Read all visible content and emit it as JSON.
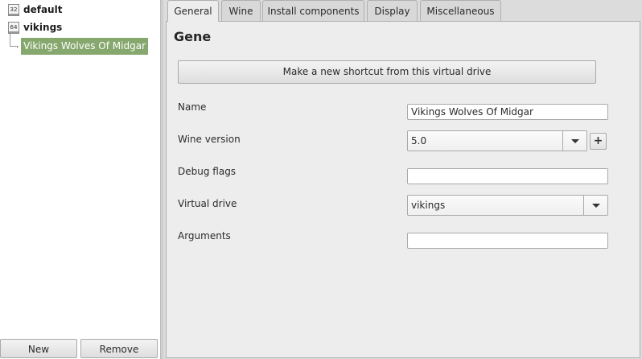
{
  "tree": {
    "items": [
      {
        "badge": "32",
        "label": "default"
      },
      {
        "badge": "64",
        "label": "vikings"
      }
    ],
    "selected_shortcut": "Vikings Wolves Of Midgar"
  },
  "left_buttons": {
    "new_label": "New",
    "remove_label": "Remove"
  },
  "tabs": [
    "General",
    "Wine",
    "Install components",
    "Display",
    "Miscellaneous"
  ],
  "active_tab": "General",
  "general": {
    "heading": "Gene",
    "make_shortcut_label": "Make a new shortcut from this virtual drive",
    "name_label": "Name",
    "name_value": "Vikings Wolves Of Midgar",
    "wine_version_label": "Wine version",
    "wine_version_value": "5.0",
    "plus_label": "+",
    "debug_flags_label": "Debug flags",
    "debug_flags_value": "",
    "virtual_drive_label": "Virtual drive",
    "virtual_drive_value": "vikings",
    "arguments_label": "Arguments",
    "arguments_value": ""
  },
  "colors": {
    "selection": "#86a86e",
    "panel_bg": "#ededed",
    "window_bg": "#dcdcdc"
  },
  "icons": {
    "drive": "drive-icon",
    "shortcut": "wolf-shortcut-icon",
    "dropdown": "chevron-down-icon",
    "add": "plus-icon"
  }
}
